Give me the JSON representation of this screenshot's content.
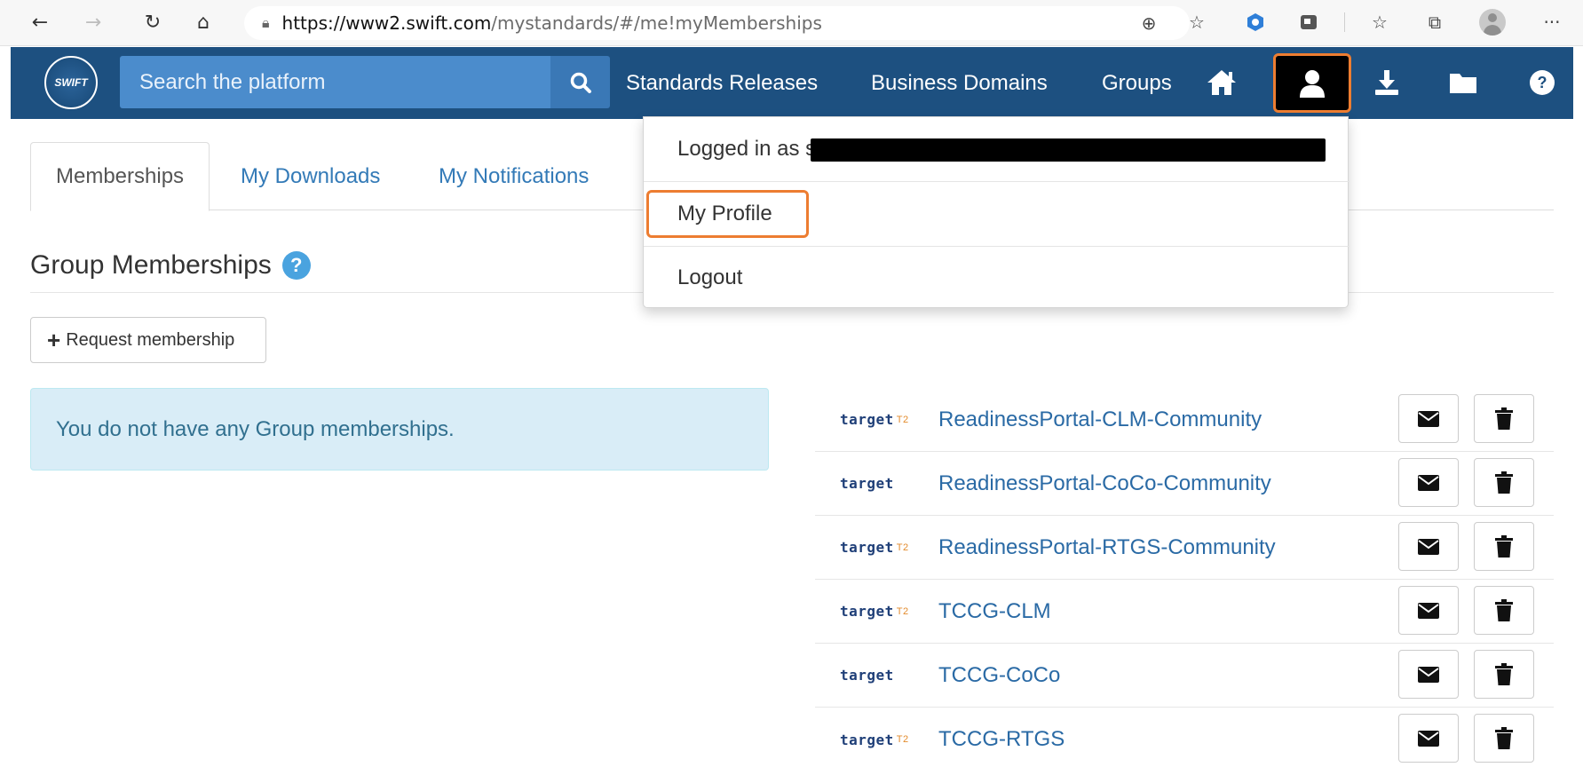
{
  "browser": {
    "url_host": "https://www2.swift.com",
    "url_path": "/mystandards/#/me!myMemberships",
    "more_label": "···"
  },
  "navbar": {
    "logo_text": "SWIFT",
    "search_placeholder": "Search the platform",
    "links": [
      "Standards Releases",
      "Business Domains",
      "Groups"
    ],
    "highlight_color": "#ed7d31",
    "brand_color": "#1d5080"
  },
  "user_menu": {
    "logged_in_prefix": "Logged in as",
    "logged_in_user_visible": "s",
    "items": [
      "My Profile",
      "Logout"
    ]
  },
  "tabs": [
    "Memberships",
    "My Downloads",
    "My Notifications"
  ],
  "section": {
    "title": "Group Memberships",
    "help": "?"
  },
  "request_button": {
    "label": "Request membership"
  },
  "alert": {
    "message": "You do not have any Group memberships."
  },
  "groups": [
    {
      "name": "ReadinessPortal-CLM-Community",
      "logo": "target",
      "suffix": "T2"
    },
    {
      "name": "ReadinessPortal-CoCo-Community",
      "logo": "target",
      "suffix": ""
    },
    {
      "name": "ReadinessPortal-RTGS-Community",
      "logo": "target",
      "suffix": "T2"
    },
    {
      "name": "TCCG-CLM",
      "logo": "target",
      "suffix": "T2"
    },
    {
      "name": "TCCG-CoCo",
      "logo": "target",
      "suffix": ""
    },
    {
      "name": "TCCG-RTGS",
      "logo": "target",
      "suffix": "T2"
    }
  ]
}
